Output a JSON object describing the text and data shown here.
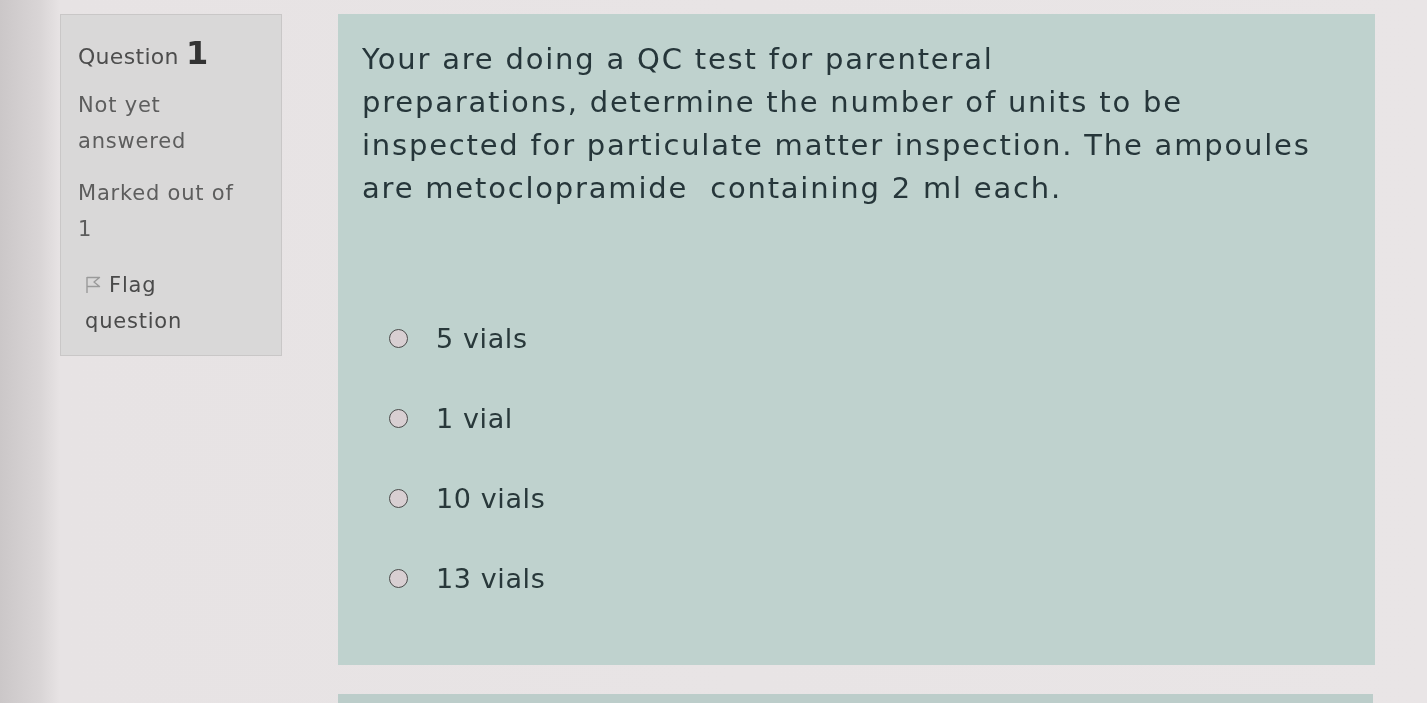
{
  "question_info": {
    "label": "Question",
    "number": "1",
    "state": "Not yet answered",
    "grade": "Marked out of 1",
    "flag": {
      "label": "Flag question",
      "flagged": false
    }
  },
  "question": {
    "paragraphs": [
      "Your are doing a QC test for parenteral",
      "preparations, determine the number of units to be inspected for particulate matter inspection. The ampoules are metoclopramide  containing 2 ml each."
    ],
    "options": [
      {
        "label": "5 vials",
        "selected": false
      },
      {
        "label": "1 vial",
        "selected": false
      },
      {
        "label": "10 vials",
        "selected": false
      },
      {
        "label": "13 vials",
        "selected": false
      }
    ]
  }
}
